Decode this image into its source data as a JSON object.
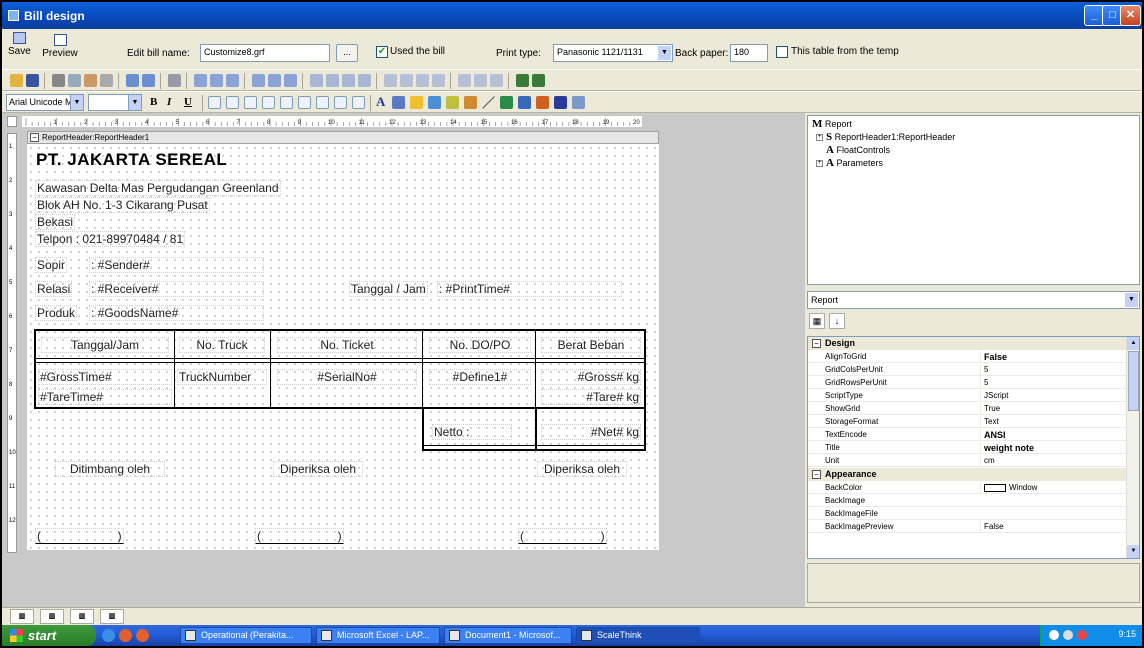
{
  "window": {
    "title": "Bill design",
    "min": "_",
    "max": "□",
    "close": "✕"
  },
  "toolbar": {
    "save_label": "Save",
    "preview_label": "Preview",
    "edit_bill_name_label": "Edit bill name:",
    "bill_name_value": "Customize8.grf",
    "browse_label": "...",
    "used_bill_label": "Used the bill",
    "used_bill_checked": true,
    "print_type_label": "Print type:",
    "print_type_value": "Panasonic 1121/1131",
    "back_paper_label": "Back paper:",
    "back_paper_value": "180",
    "template_label": "This table from the temp",
    "template_checked": false,
    "font_value": "Arial Unicode MS",
    "size_value": "",
    "bold_label": "B",
    "italic_label": "I",
    "underline_label": "U"
  },
  "designer": {
    "ruler_labels": [
      "1",
      "2",
      "3",
      "4",
      "5",
      "6",
      "7",
      "8",
      "9",
      "10",
      "11",
      "12",
      "13",
      "14",
      "15",
      "16",
      "17",
      "18",
      "19",
      "20"
    ],
    "vruler_labels": [
      "1",
      "2",
      "3",
      "4",
      "5",
      "6",
      "7",
      "8",
      "9",
      "10",
      "11",
      "12"
    ],
    "section_header": "ReportHeader:ReportHeader1",
    "company": "PT. JAKARTA SEREAL",
    "address_lines": [
      "Kawasan Delta Mas Pergudangan Greenland",
      "Blok AH No. 1-3 Cikarang Pusat",
      "Bekasi",
      "Telpon : 021-89970484 / 81"
    ],
    "sopir_label": "Sopir",
    "sopir_value": ": #Sender#",
    "relasi_label": "Relasi",
    "relasi_value": ": #Receiver#",
    "tanggal_label": "Tanggal / Jam",
    "tanggal_value": ": #PrintTime#",
    "produk_label": "Produk",
    "produk_value": ": #GoodsName#",
    "table_headers": [
      "Tanggal/Jam",
      "No. Truck",
      "No. Ticket",
      "No. DO/PO",
      "Berat Beban"
    ],
    "gross_time": "#GrossTime#",
    "tare_time": "#TareTime#",
    "truck_number": "TruckNumber",
    "serial_no": "#SerialNo#",
    "define1": "#Define1#",
    "gross_value": "#Gross# kg",
    "tare_value": "#Tare# kg",
    "netto_label": "Netto :",
    "net_value": "#Net# kg",
    "ditimbang": "Ditimbang oleh",
    "diperiksa1": "Diperiksa oleh",
    "diperiksa2": "Diperiksa oleh",
    "sign1": "(                       )",
    "sign2": "(                       )",
    "sign3": "(                       )"
  },
  "tree": {
    "root": "Report",
    "root_letter": "M",
    "items": [
      {
        "letter": "S",
        "label": "ReportHeader1:ReportHeader",
        "expander": "+"
      },
      {
        "letter": "A",
        "label": "FloatControls",
        "expander": ""
      },
      {
        "letter": "A",
        "label": "Parameters",
        "expander": "+"
      }
    ]
  },
  "properties": {
    "selected_object": "Report",
    "categories": [
      {
        "name": "Design",
        "rows": [
          {
            "name": "AlignToGrid",
            "value": "False",
            "bold": true
          },
          {
            "name": "GridColsPerUnit",
            "value": "5",
            "bold": false
          },
          {
            "name": "GridRowsPerUnit",
            "value": "5",
            "bold": false
          },
          {
            "name": "ScriptType",
            "value": "JScript",
            "bold": false
          },
          {
            "name": "ShowGrid",
            "value": "True",
            "bold": false
          },
          {
            "name": "StorageFormat",
            "value": "Text",
            "bold": false
          },
          {
            "name": "TextEncode",
            "value": "ANSI",
            "bold": true
          },
          {
            "name": "Title",
            "value": "weight note",
            "bold": true
          },
          {
            "name": "Unit",
            "value": "cm",
            "bold": false
          }
        ]
      },
      {
        "name": "Appearance",
        "rows": [
          {
            "name": "BackColor",
            "value": "Window",
            "bold": false,
            "swatch": true
          },
          {
            "name": "BackImage",
            "value": "",
            "bold": false
          },
          {
            "name": "BackImageFile",
            "value": "",
            "bold": false
          },
          {
            "name": "BackImagePreview",
            "value": "False",
            "bold": false
          }
        ]
      }
    ]
  },
  "bottom_tabs": [
    "▥",
    "▥",
    "▥",
    "▥"
  ],
  "taskbar": {
    "start_label": "start",
    "tasks": [
      "Operational (Perakita...",
      "Microsoft Excel - LAP...",
      "Document1 - Microsof...",
      "ScaleThink"
    ],
    "clock": "9:15"
  }
}
